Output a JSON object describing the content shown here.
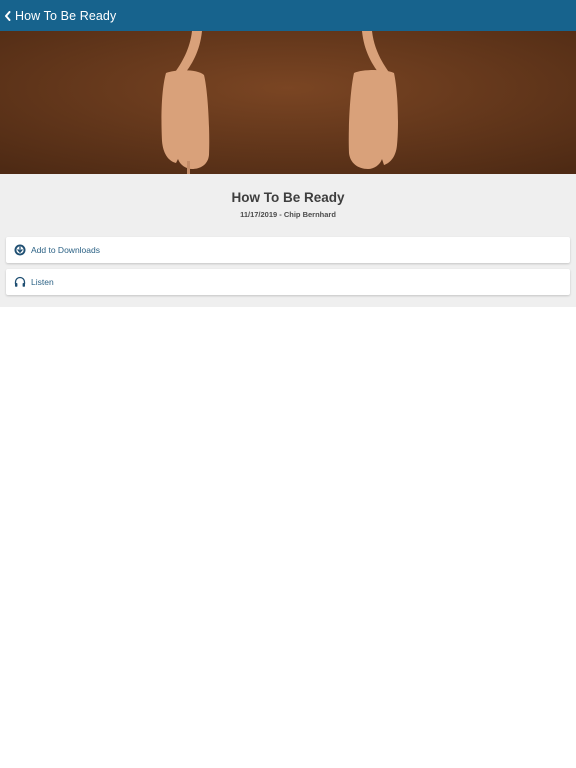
{
  "header": {
    "back_icon": "chevron-left-icon",
    "title": "How To Be Ready",
    "bar_color": "#17638d"
  },
  "hero": {
    "image": "headphones-artwork",
    "background_color": "#6b3a1f",
    "headphone_color": "#d9a17a"
  },
  "sermon": {
    "title": "How To Be Ready",
    "meta": "11/17/2019 - Chip Bernhard"
  },
  "actions": [
    {
      "icon": "download-circle-icon",
      "label": "Add to Downloads"
    },
    {
      "icon": "headphones-icon",
      "label": "Listen"
    }
  ]
}
